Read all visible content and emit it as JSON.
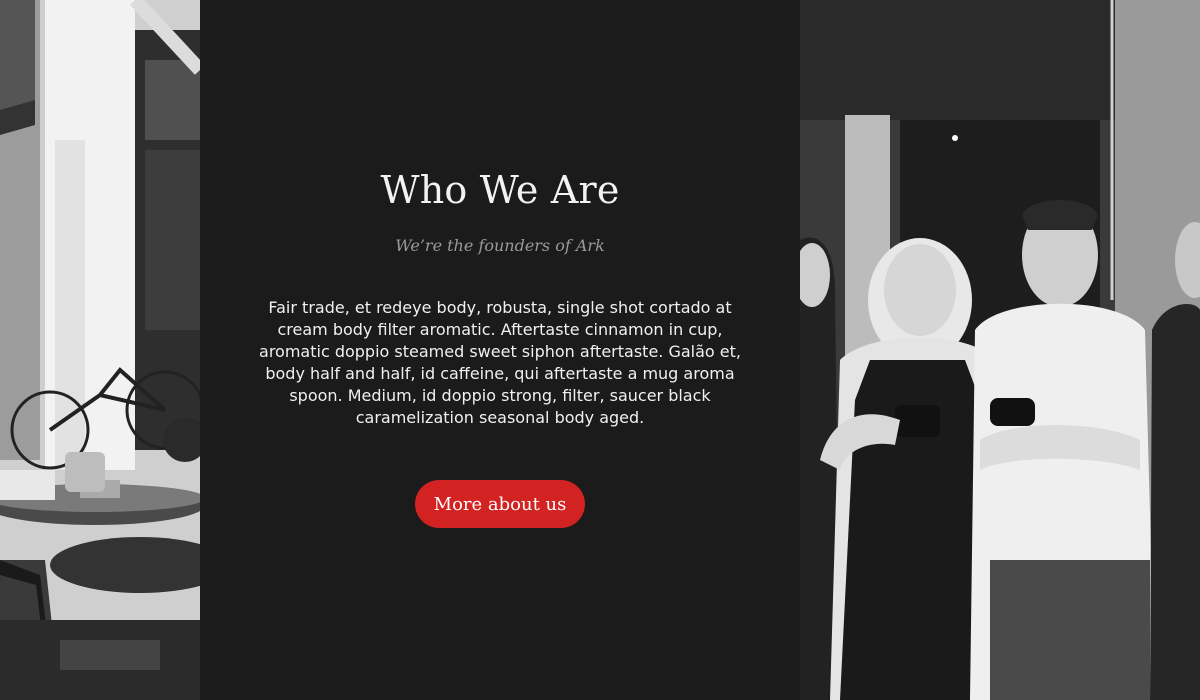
{
  "about": {
    "title": "Who We Are",
    "subtitle": "We’re the founders of Ark",
    "body": "Fair trade, et redeye body, robusta, single shot cortado at cream body filter aromatic. Aftertaste cinnamon in cup, aromatic doppio steamed sweet siphon aftertaste. Galão et, body half and half, id caffeine, qui aftertaste a mug aroma spoon. Medium, id doppio strong, filter, saucer black caramelization seasonal body aged.",
    "button_label": "More about us"
  },
  "colors": {
    "background": "#1b1b1c",
    "accent": "#d22222",
    "title_text": "#f2f2f2",
    "subtitle_text": "#9a9a9a"
  },
  "images": {
    "left": "cafe-street-photo",
    "right": "team-photo"
  }
}
